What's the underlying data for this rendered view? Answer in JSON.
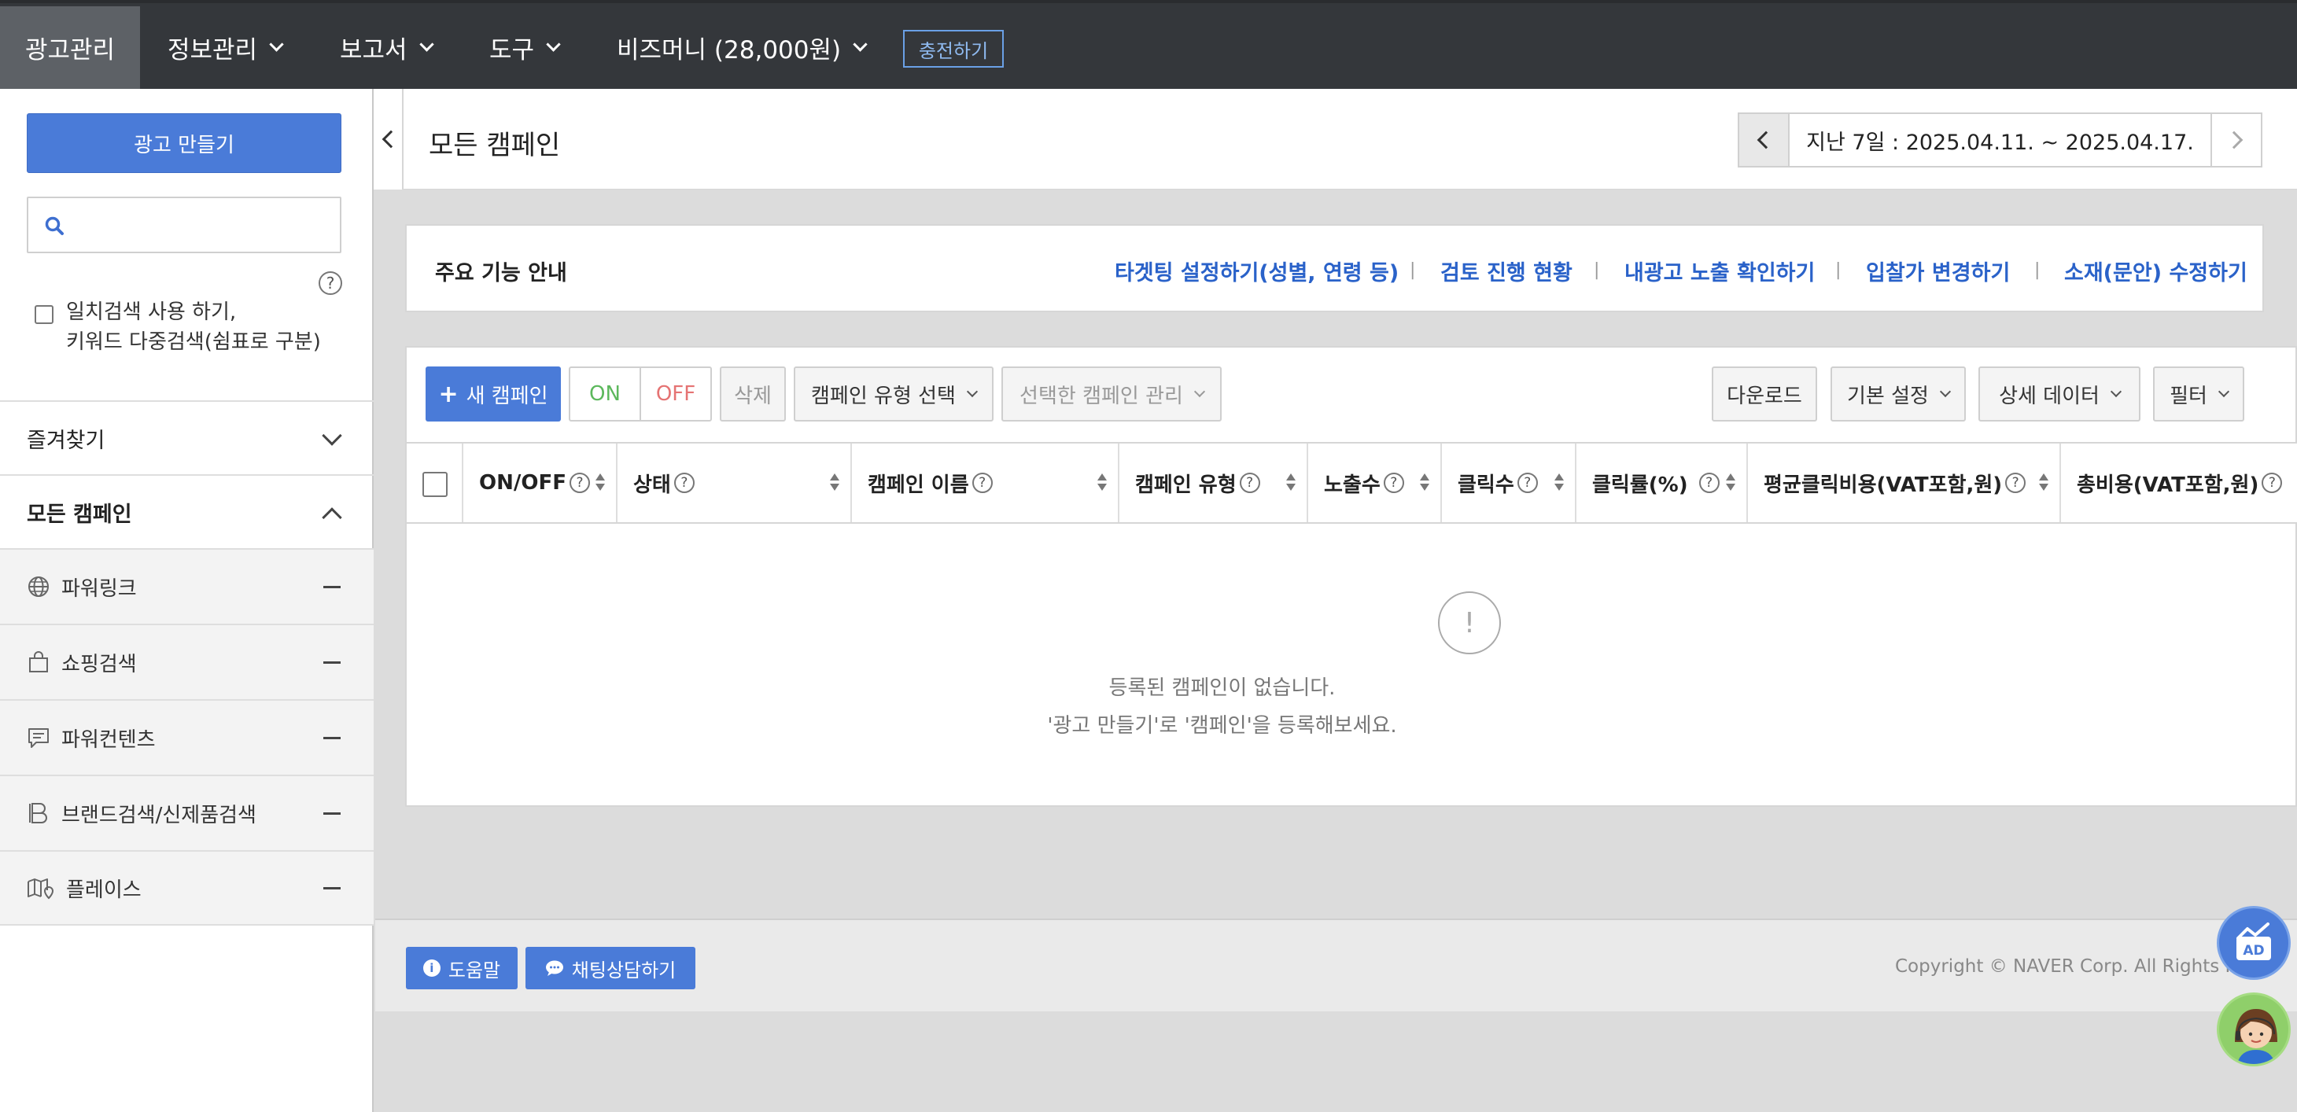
{
  "nav": {
    "items": [
      {
        "label": "광고관리",
        "dropdown": false,
        "active": true
      },
      {
        "label": "정보관리",
        "dropdown": true
      },
      {
        "label": "보고서",
        "dropdown": true
      },
      {
        "label": "도구",
        "dropdown": true
      },
      {
        "label": "비즈머니 (28,000원)",
        "dropdown": true
      }
    ],
    "charge_label": "충전하기"
  },
  "sidebar": {
    "create_label": "광고 만들기",
    "search_placeholder": "",
    "exact_search_line1": "일치검색 사용 하기,",
    "exact_search_line2": "키워드 다중검색(쉼표로 구분)",
    "favorites_label": "즐겨찾기",
    "all_campaigns_label": "모든 캠페인",
    "campaign_types": [
      {
        "label": "파워링크",
        "icon": "globe-icon"
      },
      {
        "label": "쇼핑검색",
        "icon": "shopping-bag-icon"
      },
      {
        "label": "파워컨텐츠",
        "icon": "content-chat-icon"
      },
      {
        "label": "브랜드검색/신제품검색",
        "icon": "brand-b-icon"
      },
      {
        "label": "플레이스",
        "icon": "map-place-icon"
      }
    ]
  },
  "header": {
    "title": "모든 캠페인",
    "date_range": "지난 7일 : 2025.04.11. ~ 2025.04.17."
  },
  "guide": {
    "title": "주요 기능 안내",
    "links": [
      "타겟팅 설정하기(성별, 연령 등)",
      "검토 진행 현황",
      "내광고 노출 확인하기",
      "입찰가 변경하기",
      "소재(문안) 수정하기"
    ]
  },
  "toolbar": {
    "new_campaign": "새 캠페인",
    "on": "ON",
    "off": "OFF",
    "delete": "삭제",
    "campaign_type_select": "캠페인 유형 선택",
    "manage_selected": "선택한 캠페인 관리",
    "download": "다운로드",
    "basic_settings": "기본 설정",
    "detail_data": "상세 데이터",
    "filter": "필터"
  },
  "table": {
    "columns": [
      "ON/OFF",
      "상태",
      "캠페인 이름",
      "캠페인 유형",
      "노출수",
      "클릭수",
      "클릭률(%)",
      "평균클릭비용(VAT포함,원)",
      "총비용(VAT포함,원)"
    ],
    "empty_line1": "등록된 캠페인이 없습니다.",
    "empty_line2": "'광고 만들기'로 '캠페인'을 등록해보세요."
  },
  "footer": {
    "help": "도움말",
    "chat": "채팅상담하기",
    "copyright": "Copyright © NAVER Corp. All Rights Rese"
  },
  "colors": {
    "nav_bg": "#34373b",
    "primary": "#4a7bd8",
    "link": "#2a62c9",
    "on_green": "#5cb85c",
    "off_red": "#e57373"
  }
}
